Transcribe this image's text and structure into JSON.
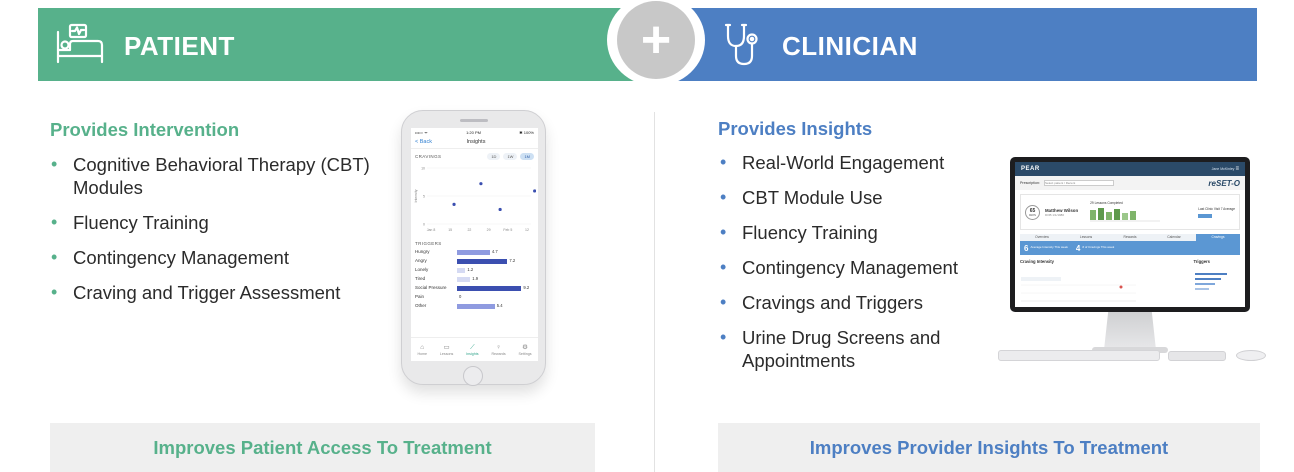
{
  "patient": {
    "banner_title": "PATIENT",
    "section_title": "Provides Intervention",
    "bullets": [
      "Cognitive Behavioral Therapy (CBT) Modules",
      "Fluency Training",
      "Contingency Management",
      "Craving and Trigger Assessment"
    ],
    "footer": "Improves Patient Access To Treatment",
    "accent_color": "#57b18b",
    "icon": "hospital-bed-icon"
  },
  "clinician": {
    "banner_title": "CLINICIAN",
    "section_title": "Provides Insights",
    "bullets": [
      "Real-World Engagement",
      "CBT Module Use",
      "Fluency Training",
      "Contingency Management",
      "Cravings and Triggers",
      "Urine Drug Screens and Appointments"
    ],
    "footer": "Improves Provider Insights To Treatment",
    "accent_color": "#4d7fc3",
    "icon": "stethoscope-icon"
  },
  "plus_symbol": "+",
  "phone_app": {
    "status_left": "••••○ ᯤ",
    "status_time": "1:20 PM",
    "status_battery": "✱ 100%",
    "back_label": "< Back",
    "screen_title": "Insights",
    "cravings_label": "CRAVINGS",
    "range_options": [
      "1D",
      "1W",
      "1M"
    ],
    "active_range": "1M",
    "y_axis_label": "Intensity",
    "y_ticks": [
      "10",
      "5",
      "0"
    ],
    "x_ticks": [
      "Jan 8",
      "15",
      "22",
      "29",
      "Feb 5",
      "12"
    ],
    "craving_points": [
      {
        "x": 1.2,
        "y": 3.5
      },
      {
        "x": 2.6,
        "y": 7.2
      },
      {
        "x": 3.6,
        "y": 2.6
      },
      {
        "x": 5.4,
        "y": 5.9
      }
    ],
    "triggers_label": "TRIGGERS",
    "triggers": [
      {
        "name": "Hungry",
        "value": 4.7
      },
      {
        "name": "Angry",
        "value": 7.2
      },
      {
        "name": "Lonely",
        "value": 1.2
      },
      {
        "name": "Tired",
        "value": 1.9
      },
      {
        "name": "Social Pressure",
        "value": 9.2
      },
      {
        "name": "Pain",
        "value": 0
      },
      {
        "name": "Other",
        "value": 5.4
      }
    ],
    "tabs": [
      {
        "label": "Home",
        "glyph": "⌂",
        "active": false
      },
      {
        "label": "Lessons",
        "glyph": "▭",
        "active": false
      },
      {
        "label": "Insights",
        "glyph": "⟋",
        "active": true
      },
      {
        "label": "Rewards",
        "glyph": "♀",
        "active": false
      },
      {
        "label": "Settings",
        "glyph": "⚙",
        "active": false
      }
    ]
  },
  "desktop_app": {
    "brand": "PEAR",
    "user": "Jane McKinley",
    "prescription_label": "Prescription:",
    "prescription_value": "Select patient / Recent",
    "product_logo": "reSET-O",
    "patient_name": "Matthew Wilson",
    "patient_avatar_value": "65",
    "patient_avatar_unit": "DAYS",
    "patient_details": "DOB 1/1/1980",
    "lessons_label": "29 Lessons Completed",
    "last_visit_label": "Last Clinic Visit 7 Average",
    "tabs": [
      "Overview",
      "Lessons",
      "Rewards",
      "Calendar",
      "Cravings"
    ],
    "active_tab": "Cravings",
    "stats": [
      {
        "number": "6",
        "label": "Average Intensity This week"
      },
      {
        "number": "4",
        "label": "# of Cravings This week"
      }
    ],
    "section_left": "Craving Intensity",
    "section_right": "Triggers"
  }
}
